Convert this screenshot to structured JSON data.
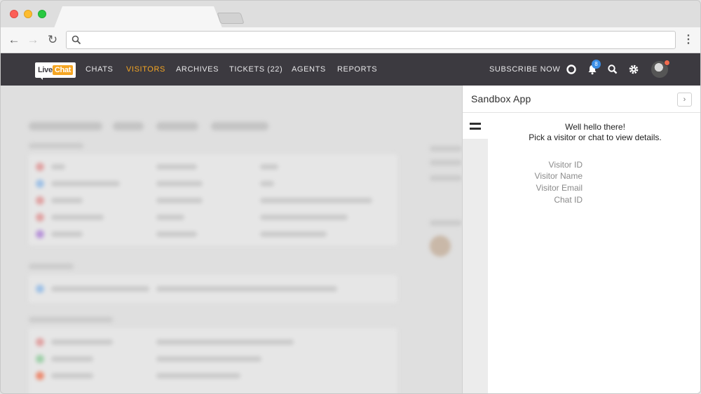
{
  "browser": {
    "url": ""
  },
  "app": {
    "logo_prefix": "Live",
    "logo_suffix": "Chat",
    "nav": [
      {
        "label": "CHATS",
        "active": false
      },
      {
        "label": "VISITORS",
        "active": true
      },
      {
        "label": "ARCHIVES",
        "active": false
      },
      {
        "label": "TICKETS (22)",
        "active": false
      },
      {
        "label": "AGENTS",
        "active": false
      },
      {
        "label": "REPORTS",
        "active": false
      }
    ],
    "subscribe_label": "SUBSCRIBE NOW",
    "notification_count": "8",
    "icons": [
      "help-icon",
      "bell-icon",
      "search-icon",
      "gear-icon"
    ],
    "colors": {
      "accent": "#f5a623",
      "header": "#3c3a40",
      "badge": "#3a8ee6",
      "status": "#f26b4e"
    }
  },
  "panel": {
    "title": "Sandbox App",
    "expand_icon": "chevron-right-icon",
    "menu_icon": "hamburger-icon",
    "greeting_line1": "Well hello there!",
    "greeting_line2": "Pick a visitor or chat to view details.",
    "fields": [
      "Visitor ID",
      "Visitor Name",
      "Visitor Email",
      "Chat ID"
    ]
  }
}
